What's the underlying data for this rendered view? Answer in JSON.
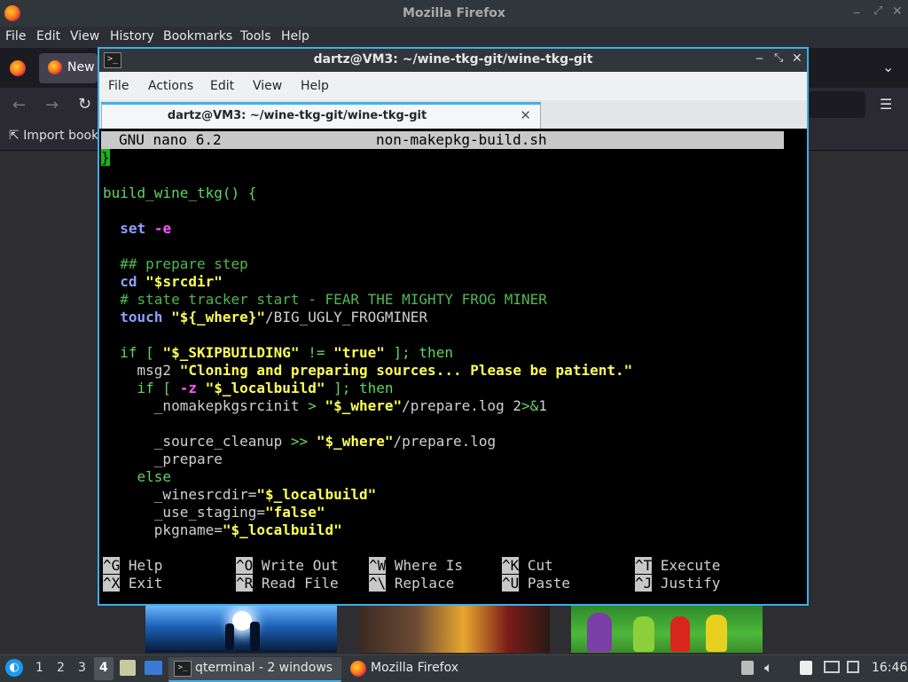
{
  "firefox": {
    "title": "Mozilla Firefox",
    "menu": [
      "File",
      "Edit",
      "View",
      "History",
      "Bookmarks",
      "Tools",
      "Help"
    ],
    "menu_accel": [
      "F",
      "E",
      "V",
      "S",
      "B",
      "T",
      "H"
    ],
    "tab_label": "New",
    "bookmark_import": "Import book",
    "window_controls": [
      "minimize",
      "maximize",
      "close"
    ]
  },
  "terminal": {
    "title": "dartz@VM3: ~/wine-tkg-git/wine-tkg-git",
    "menu": [
      "File",
      "Actions",
      "Edit",
      "View",
      "Help"
    ],
    "tab_label": "dartz@VM3: ~/wine-tkg-git/wine-tkg-git",
    "nano": {
      "version": "GNU nano 6.2",
      "filename": "non-makepkg-build.sh",
      "cursor_char": "}",
      "lines": [
        {
          "segs": [
            {
              "t": "build_wine_tkg",
              "c": "g"
            },
            {
              "t": "() {",
              "c": "g"
            }
          ]
        },
        {
          "segs": []
        },
        {
          "segs": [
            {
              "t": "  ",
              "c": ""
            },
            {
              "t": "set",
              "c": "k"
            },
            {
              "t": " ",
              "c": ""
            },
            {
              "t": "-e",
              "c": "m"
            }
          ]
        },
        {
          "segs": []
        },
        {
          "segs": [
            {
              "t": "  ## prepare step",
              "c": "gb"
            }
          ]
        },
        {
          "segs": [
            {
              "t": "  ",
              "c": ""
            },
            {
              "t": "cd",
              "c": "k"
            },
            {
              "t": " ",
              "c": ""
            },
            {
              "t": "\"$srcdir\"",
              "c": "y"
            }
          ]
        },
        {
          "segs": [
            {
              "t": "  # state tracker start - FEAR THE MIGHTY FROG MINER",
              "c": "gb"
            }
          ]
        },
        {
          "segs": [
            {
              "t": "  ",
              "c": ""
            },
            {
              "t": "touch",
              "c": "k"
            },
            {
              "t": " ",
              "c": ""
            },
            {
              "t": "\"${_where}\"",
              "c": "y"
            },
            {
              "t": "/BIG_UGLY_FROGMINER",
              "c": ""
            }
          ]
        },
        {
          "segs": []
        },
        {
          "segs": [
            {
              "t": "  ",
              "c": ""
            },
            {
              "t": "if",
              "c": "g"
            },
            {
              "t": " [ ",
              "c": "g"
            },
            {
              "t": "\"$_SKIPBUILDING\"",
              "c": "y"
            },
            {
              "t": " != ",
              "c": "g"
            },
            {
              "t": "\"true\"",
              "c": "y"
            },
            {
              "t": " ]; then",
              "c": "g"
            }
          ]
        },
        {
          "segs": [
            {
              "t": "    msg2 ",
              "c": ""
            },
            {
              "t": "\"Cloning and preparing sources... Please be patient.\"",
              "c": "y"
            }
          ]
        },
        {
          "segs": [
            {
              "t": "    ",
              "c": ""
            },
            {
              "t": "if",
              "c": "g"
            },
            {
              "t": " [ ",
              "c": "g"
            },
            {
              "t": "-z",
              "c": "m"
            },
            {
              "t": " ",
              "c": ""
            },
            {
              "t": "\"$_localbuild\"",
              "c": "y"
            },
            {
              "t": " ]; then",
              "c": "g"
            }
          ]
        },
        {
          "segs": [
            {
              "t": "      _nomakepkgsrcinit ",
              "c": ""
            },
            {
              "t": ">",
              "c": "g"
            },
            {
              "t": " ",
              "c": ""
            },
            {
              "t": "\"$_where\"",
              "c": "y"
            },
            {
              "t": "/prepare.log 2",
              "c": ""
            },
            {
              "t": ">&",
              "c": "g"
            },
            {
              "t": "1",
              "c": ""
            }
          ]
        },
        {
          "segs": []
        },
        {
          "segs": [
            {
              "t": "      _source_cleanup ",
              "c": ""
            },
            {
              "t": ">>",
              "c": "g"
            },
            {
              "t": " ",
              "c": ""
            },
            {
              "t": "\"$_where\"",
              "c": "y"
            },
            {
              "t": "/prepare.log",
              "c": ""
            }
          ]
        },
        {
          "segs": [
            {
              "t": "      _prepare",
              "c": ""
            }
          ]
        },
        {
          "segs": [
            {
              "t": "    else",
              "c": "g"
            }
          ]
        },
        {
          "segs": [
            {
              "t": "      _winesrcdir=",
              "c": ""
            },
            {
              "t": "\"$_localbuild\"",
              "c": "y"
            }
          ]
        },
        {
          "segs": [
            {
              "t": "      _use_staging=",
              "c": ""
            },
            {
              "t": "\"false\"",
              "c": "y"
            }
          ]
        },
        {
          "segs": [
            {
              "t": "      pkgname=",
              "c": ""
            },
            {
              "t": "\"$_localbuild\"",
              "c": "y"
            }
          ]
        }
      ],
      "shortcuts": [
        {
          "key": "^G",
          "label": "Help"
        },
        {
          "key": "^O",
          "label": "Write Out"
        },
        {
          "key": "^W",
          "label": "Where Is"
        },
        {
          "key": "^K",
          "label": "Cut"
        },
        {
          "key": "^T",
          "label": "Execute"
        },
        {
          "key": "^X",
          "label": "Exit"
        },
        {
          "key": "^R",
          "label": "Read File"
        },
        {
          "key": "^\\",
          "label": "Replace"
        },
        {
          "key": "^U",
          "label": "Paste"
        },
        {
          "key": "^J",
          "label": "Justify"
        }
      ]
    }
  },
  "taskbar": {
    "workspaces": [
      "1",
      "2",
      "3",
      "4"
    ],
    "active_workspace": "4",
    "tasks": [
      {
        "label": "qterminal - 2 windows",
        "icon": "terminal-icon"
      },
      {
        "label": "Mozilla Firefox",
        "icon": "firefox-icon"
      }
    ],
    "clock": "16:46"
  }
}
